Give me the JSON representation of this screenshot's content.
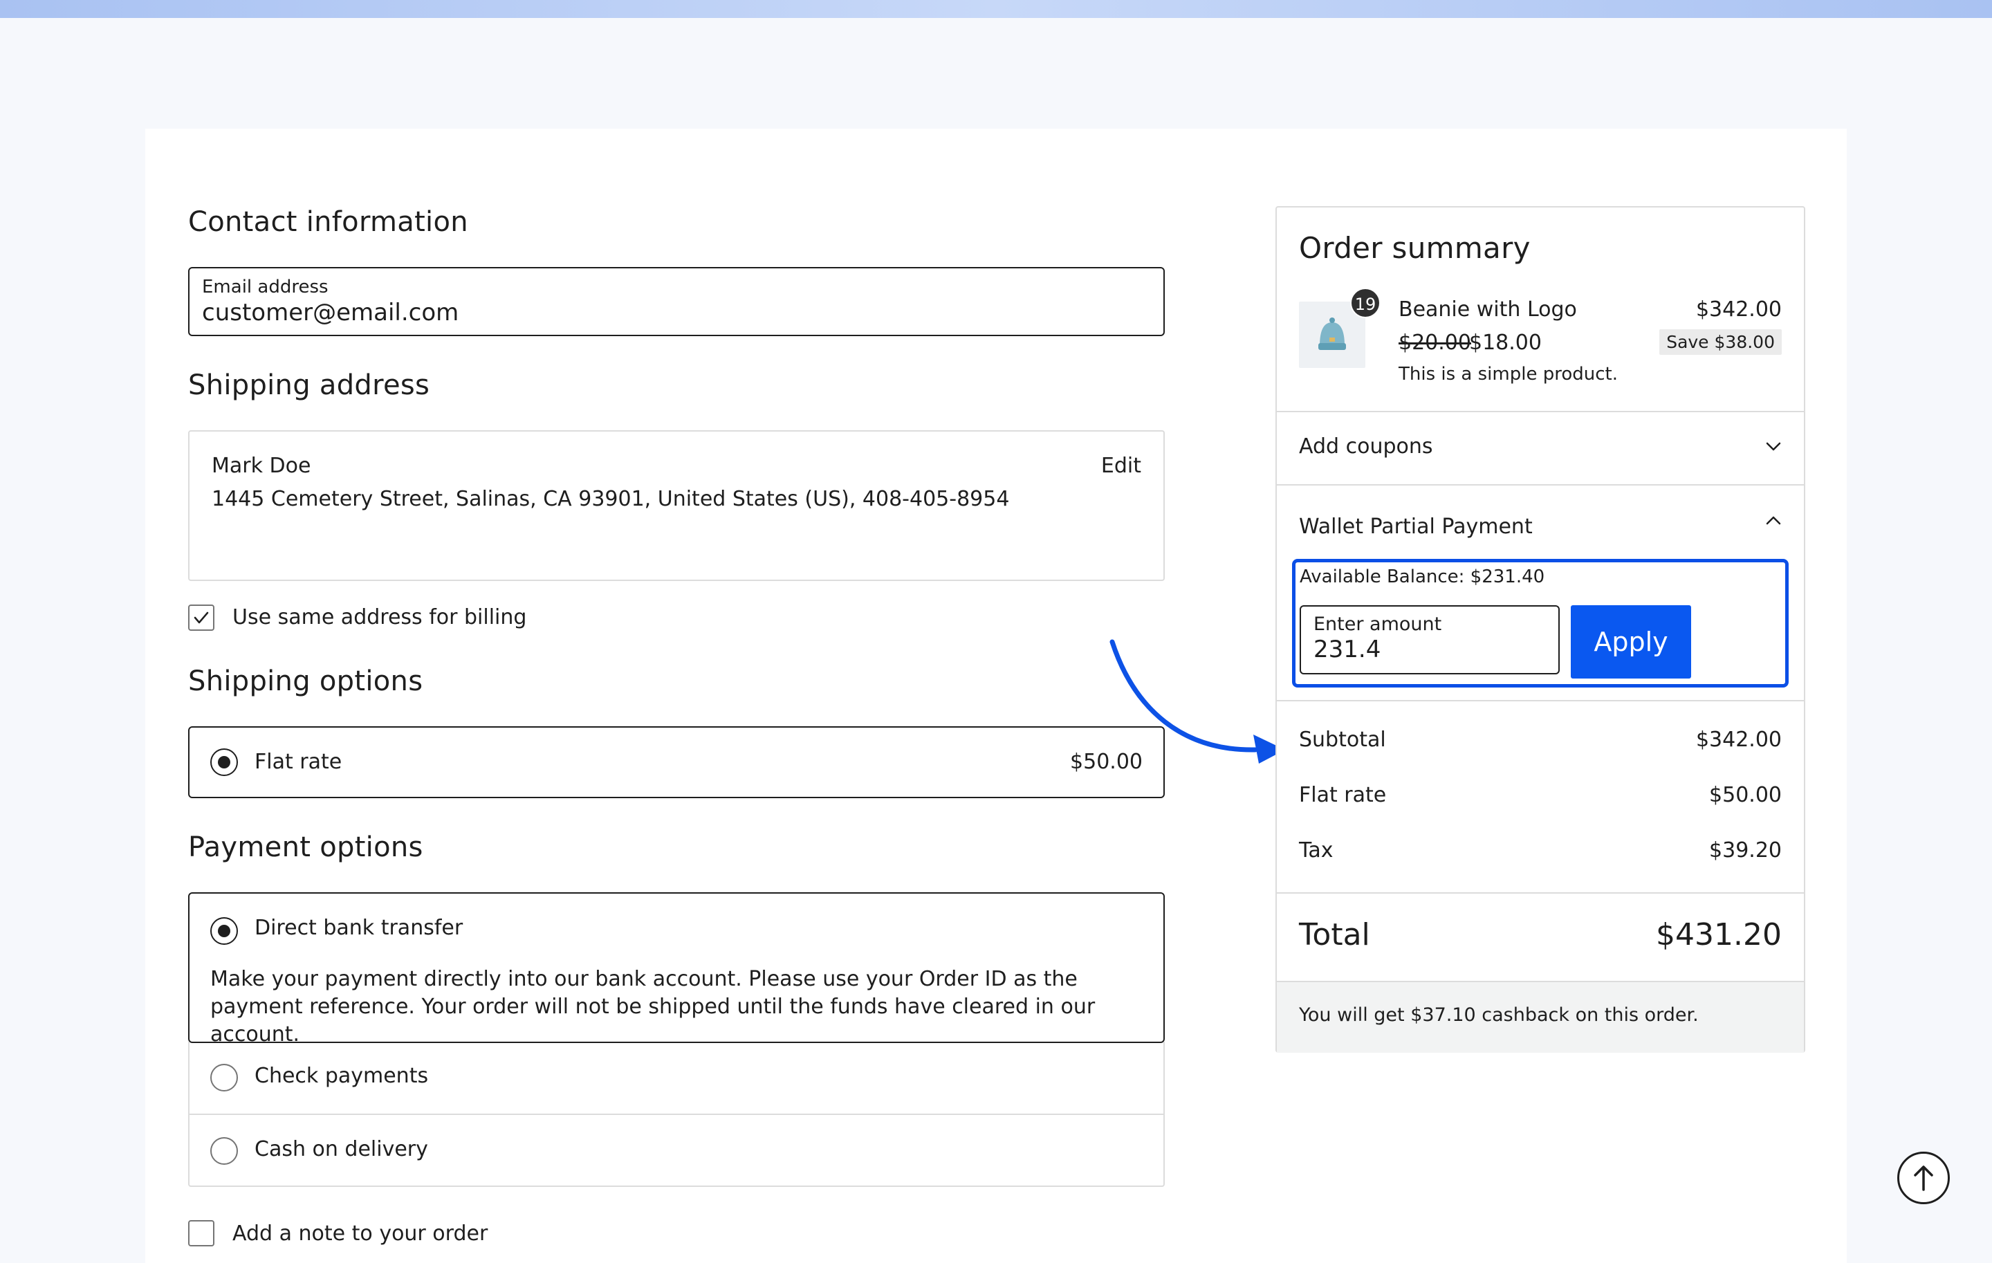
{
  "contact": {
    "heading": "Contact information",
    "email_label": "Email address",
    "email_value": "customer@email.com"
  },
  "shipping": {
    "heading": "Shipping address",
    "name": "Mark Doe",
    "address": "1445 Cemetery Street, Salinas, CA 93901, United States (US), 408-405-8954",
    "edit_label": "Edit",
    "same_billing_label": "Use same address for billing",
    "same_billing_checked": true
  },
  "shipping_options": {
    "heading": "Shipping options",
    "option_label": "Flat rate",
    "option_price": "$50.00"
  },
  "payment": {
    "heading": "Payment options",
    "options": [
      {
        "label": "Direct bank transfer",
        "selected": true,
        "description": "Make your payment directly into our bank account. Please use your Order ID as the payment reference. Your order will not be shipped until the funds have cleared in our account."
      },
      {
        "label": "Check payments",
        "selected": false
      },
      {
        "label": "Cash on delivery",
        "selected": false
      }
    ],
    "note_label": "Add a note to your order"
  },
  "summary": {
    "heading": "Order summary",
    "product": {
      "quantity": "19",
      "name": "Beanie with Logo",
      "total": "$342.00",
      "regular_price": "$20.00",
      "sale_price": "$18.00",
      "save_badge": "Save $38.00",
      "description": "This is a simple product."
    },
    "coupons_label": "Add coupons",
    "wallet": {
      "label": "Wallet Partial Payment",
      "balance_text": "Available Balance: $231.40",
      "amount_label": "Enter amount",
      "amount_value": "231.4",
      "apply_label": "Apply"
    },
    "subtotal_label": "Subtotal",
    "subtotal_value": "$342.00",
    "shipping_label": "Flat rate",
    "shipping_value": "$50.00",
    "tax_label": "Tax",
    "tax_value": "$39.20",
    "total_label": "Total",
    "total_value": "$431.20",
    "cashback_text": "You will get $37.10 cashback on this order."
  },
  "colors": {
    "accent": "#0a58f0",
    "highlight_border": "#0b4fe6",
    "arrow": "#0d52e6"
  },
  "icons": {
    "checkbox": "check-icon",
    "coupons": "chevron-down-icon",
    "wallet": "chevron-up-icon",
    "scroll": "arrow-up-icon"
  }
}
